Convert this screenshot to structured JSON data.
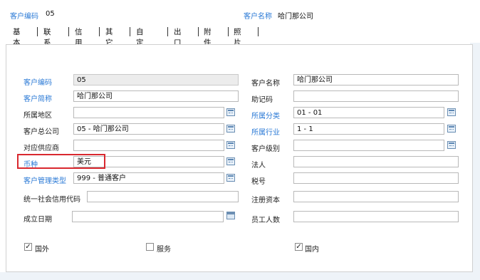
{
  "header": {
    "code_label": "客户编码",
    "code_value": "05",
    "name_label": "客户名称",
    "name_value": "哈门那公司"
  },
  "tabs": [
    "基本",
    "联系",
    "信用",
    "其它",
    "自定义",
    "出口",
    "附件",
    "照片"
  ],
  "form": {
    "left": [
      {
        "label": "客户编码",
        "value": "05",
        "label_color": "#2b7ad6",
        "readonly": true,
        "lookup": false
      },
      {
        "label": "客户简称",
        "value": "哈门那公司",
        "label_color": "#2b7ad6",
        "readonly": false,
        "lookup": false
      },
      {
        "label": "所属地区",
        "value": "",
        "label_color": "#222222",
        "readonly": false,
        "lookup": true
      },
      {
        "label": "客户总公司",
        "value": "05 - 哈门那公司",
        "label_color": "#222222",
        "readonly": false,
        "lookup": true
      },
      {
        "label": "对应供应商",
        "value": "",
        "label_color": "#222222",
        "readonly": false,
        "lookup": true
      },
      {
        "label": "币种",
        "value": "美元",
        "label_color": "#2b7ad6",
        "readonly": false,
        "lookup": true
      },
      {
        "label": "客户管理类型",
        "value": "999 - 普通客户",
        "label_color": "#2b7ad6",
        "readonly": false,
        "lookup": true
      },
      {
        "label": "统一社会信用代码",
        "value": "",
        "label_color": "#222222",
        "readonly": false,
        "lookup": false
      },
      {
        "label": "成立日期",
        "value": "",
        "label_color": "#222222",
        "readonly": false,
        "lookup": false,
        "calendar": true
      }
    ],
    "right": [
      {
        "label": "客户名称",
        "value": "哈门那公司",
        "label_color": "#222222",
        "readonly": false,
        "lookup": false
      },
      {
        "label": "助记码",
        "value": "",
        "label_color": "#222222",
        "readonly": false,
        "lookup": false
      },
      {
        "label": "所属分类",
        "value": "01 - 01",
        "label_color": "#2b7ad6",
        "readonly": false,
        "lookup": true
      },
      {
        "label": "所属行业",
        "value": "1 - 1",
        "label_color": "#2b7ad6",
        "readonly": false,
        "lookup": true
      },
      {
        "label": "客户级别",
        "value": "",
        "label_color": "#222222",
        "readonly": false,
        "lookup": true
      },
      {
        "label": "法人",
        "value": "",
        "label_color": "#222222",
        "readonly": false,
        "lookup": false
      },
      {
        "label": "税号",
        "value": "",
        "label_color": "#222222",
        "readonly": false,
        "lookup": false
      },
      {
        "label": "注册资本",
        "value": "",
        "label_color": "#222222",
        "readonly": false,
        "lookup": false
      },
      {
        "label": "员工人数",
        "value": "",
        "label_color": "#222222",
        "readonly": false,
        "lookup": false
      }
    ]
  },
  "checkboxes": [
    {
      "label": "国外",
      "checked": true,
      "mark": "✓"
    },
    {
      "label": "服务",
      "checked": false,
      "mark": ""
    },
    {
      "label": "国内",
      "checked": true,
      "mark": "✓"
    }
  ],
  "colors": {
    "label_blue": "#2b7ad6",
    "highlight_red": "#d9282f"
  }
}
